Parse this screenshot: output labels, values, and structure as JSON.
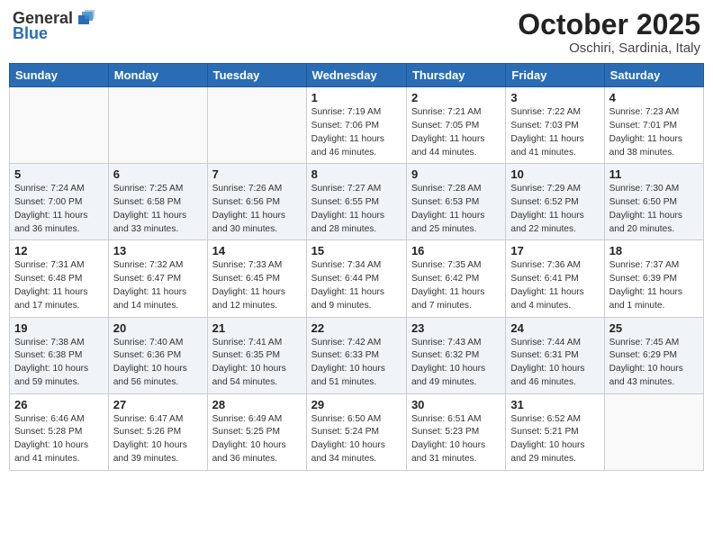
{
  "header": {
    "logo_general": "General",
    "logo_blue": "Blue",
    "month_year": "October 2025",
    "location": "Oschiri, Sardinia, Italy"
  },
  "days_of_week": [
    "Sunday",
    "Monday",
    "Tuesday",
    "Wednesday",
    "Thursday",
    "Friday",
    "Saturday"
  ],
  "weeks": [
    {
      "days": [
        {
          "number": "",
          "info": ""
        },
        {
          "number": "",
          "info": ""
        },
        {
          "number": "",
          "info": ""
        },
        {
          "number": "1",
          "info": "Sunrise: 7:19 AM\nSunset: 7:06 PM\nDaylight: 11 hours and 46 minutes."
        },
        {
          "number": "2",
          "info": "Sunrise: 7:21 AM\nSunset: 7:05 PM\nDaylight: 11 hours and 44 minutes."
        },
        {
          "number": "3",
          "info": "Sunrise: 7:22 AM\nSunset: 7:03 PM\nDaylight: 11 hours and 41 minutes."
        },
        {
          "number": "4",
          "info": "Sunrise: 7:23 AM\nSunset: 7:01 PM\nDaylight: 11 hours and 38 minutes."
        }
      ]
    },
    {
      "days": [
        {
          "number": "5",
          "info": "Sunrise: 7:24 AM\nSunset: 7:00 PM\nDaylight: 11 hours and 36 minutes."
        },
        {
          "number": "6",
          "info": "Sunrise: 7:25 AM\nSunset: 6:58 PM\nDaylight: 11 hours and 33 minutes."
        },
        {
          "number": "7",
          "info": "Sunrise: 7:26 AM\nSunset: 6:56 PM\nDaylight: 11 hours and 30 minutes."
        },
        {
          "number": "8",
          "info": "Sunrise: 7:27 AM\nSunset: 6:55 PM\nDaylight: 11 hours and 28 minutes."
        },
        {
          "number": "9",
          "info": "Sunrise: 7:28 AM\nSunset: 6:53 PM\nDaylight: 11 hours and 25 minutes."
        },
        {
          "number": "10",
          "info": "Sunrise: 7:29 AM\nSunset: 6:52 PM\nDaylight: 11 hours and 22 minutes."
        },
        {
          "number": "11",
          "info": "Sunrise: 7:30 AM\nSunset: 6:50 PM\nDaylight: 11 hours and 20 minutes."
        }
      ]
    },
    {
      "days": [
        {
          "number": "12",
          "info": "Sunrise: 7:31 AM\nSunset: 6:48 PM\nDaylight: 11 hours and 17 minutes."
        },
        {
          "number": "13",
          "info": "Sunrise: 7:32 AM\nSunset: 6:47 PM\nDaylight: 11 hours and 14 minutes."
        },
        {
          "number": "14",
          "info": "Sunrise: 7:33 AM\nSunset: 6:45 PM\nDaylight: 11 hours and 12 minutes."
        },
        {
          "number": "15",
          "info": "Sunrise: 7:34 AM\nSunset: 6:44 PM\nDaylight: 11 hours and 9 minutes."
        },
        {
          "number": "16",
          "info": "Sunrise: 7:35 AM\nSunset: 6:42 PM\nDaylight: 11 hours and 7 minutes."
        },
        {
          "number": "17",
          "info": "Sunrise: 7:36 AM\nSunset: 6:41 PM\nDaylight: 11 hours and 4 minutes."
        },
        {
          "number": "18",
          "info": "Sunrise: 7:37 AM\nSunset: 6:39 PM\nDaylight: 11 hours and 1 minute."
        }
      ]
    },
    {
      "days": [
        {
          "number": "19",
          "info": "Sunrise: 7:38 AM\nSunset: 6:38 PM\nDaylight: 10 hours and 59 minutes."
        },
        {
          "number": "20",
          "info": "Sunrise: 7:40 AM\nSunset: 6:36 PM\nDaylight: 10 hours and 56 minutes."
        },
        {
          "number": "21",
          "info": "Sunrise: 7:41 AM\nSunset: 6:35 PM\nDaylight: 10 hours and 54 minutes."
        },
        {
          "number": "22",
          "info": "Sunrise: 7:42 AM\nSunset: 6:33 PM\nDaylight: 10 hours and 51 minutes."
        },
        {
          "number": "23",
          "info": "Sunrise: 7:43 AM\nSunset: 6:32 PM\nDaylight: 10 hours and 49 minutes."
        },
        {
          "number": "24",
          "info": "Sunrise: 7:44 AM\nSunset: 6:31 PM\nDaylight: 10 hours and 46 minutes."
        },
        {
          "number": "25",
          "info": "Sunrise: 7:45 AM\nSunset: 6:29 PM\nDaylight: 10 hours and 43 minutes."
        }
      ]
    },
    {
      "days": [
        {
          "number": "26",
          "info": "Sunrise: 6:46 AM\nSunset: 5:28 PM\nDaylight: 10 hours and 41 minutes."
        },
        {
          "number": "27",
          "info": "Sunrise: 6:47 AM\nSunset: 5:26 PM\nDaylight: 10 hours and 39 minutes."
        },
        {
          "number": "28",
          "info": "Sunrise: 6:49 AM\nSunset: 5:25 PM\nDaylight: 10 hours and 36 minutes."
        },
        {
          "number": "29",
          "info": "Sunrise: 6:50 AM\nSunset: 5:24 PM\nDaylight: 10 hours and 34 minutes."
        },
        {
          "number": "30",
          "info": "Sunrise: 6:51 AM\nSunset: 5:23 PM\nDaylight: 10 hours and 31 minutes."
        },
        {
          "number": "31",
          "info": "Sunrise: 6:52 AM\nSunset: 5:21 PM\nDaylight: 10 hours and 29 minutes."
        },
        {
          "number": "",
          "info": ""
        }
      ]
    }
  ]
}
